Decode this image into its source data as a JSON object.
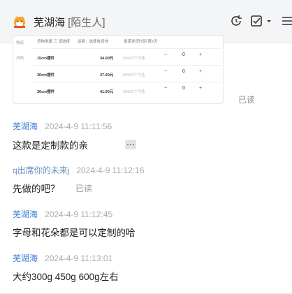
{
  "header": {
    "contact_name": "芜湖海",
    "stranger_tag": "[陌生人]",
    "icons": [
      "avatar-icon",
      "refresh-icon",
      "check-square-icon",
      "menu-icon"
    ]
  },
  "product_card": {
    "header_labels": [
      "货物类属 三 请选择",
      "运费：选择收货地",
      "承诺发货时间 第2天"
    ],
    "side_labels": [
      "物流",
      "尺码"
    ],
    "rows": [
      {
        "name": "15cm摆件",
        "price": "34.00元",
        "stock": "99999个可售",
        "qty": "0"
      },
      {
        "name": "30cm摆件",
        "price": "37.00元",
        "stock": "99999个可售",
        "qty": "0"
      },
      {
        "name": "30cm摆件",
        "price": "41.00元",
        "stock": "99999个可售",
        "qty": "0"
      }
    ],
    "read_status": "已读"
  },
  "messages": [
    {
      "sender": "芜湖海",
      "time": "2024-4-9 11:11:56",
      "text": "这款是定制款的亲"
    },
    {
      "sender": "q出席你的未来j",
      "time": "2024-4-9 11:12:16",
      "text": "先做的吧？",
      "read_status": "已读"
    },
    {
      "sender": "芜湖海",
      "time": "2024-4-9 11:12:45",
      "text": "字母和花朵都是可以定制的哈"
    },
    {
      "sender": "芜湖海",
      "time": "2024-4-9 11:13:01",
      "text": "大约300g 450g 600g左右"
    }
  ],
  "colors": {
    "sender_blue": "#3a7bd5",
    "header_bg": "#f4f5f7",
    "muted_text": "#999999"
  }
}
